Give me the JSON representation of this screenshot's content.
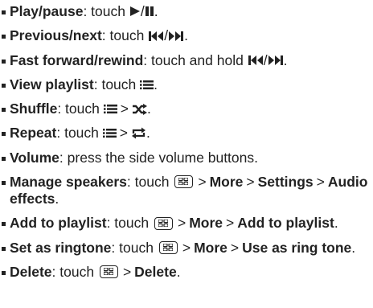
{
  "items": [
    {
      "term": "Play/pause",
      "pre": ": touch ",
      "icons": [
        "play-icon",
        "pause-icon"
      ],
      "sep": "/",
      "end": "."
    },
    {
      "term": "Previous/next",
      "pre": ": touch ",
      "icons": [
        "previous-icon",
        "next-icon"
      ],
      "sep": "/",
      "end": "."
    },
    {
      "term": "Fast forward/rewind",
      "pre": ": touch and hold ",
      "icons": [
        "previous-icon",
        "next-icon"
      ],
      "sep": "/",
      "end": "."
    },
    {
      "term": "View playlist",
      "pre": ": touch ",
      "icons": [
        "playlist-icon"
      ],
      "end": "."
    },
    {
      "term": "Shuffle",
      "pre": ": touch ",
      "icons": [
        "playlist-icon",
        "shuffle-icon"
      ],
      "gt": ">",
      "end": "."
    },
    {
      "term": "Repeat",
      "pre": ": touch ",
      "icons": [
        "playlist-icon",
        "repeat-icon"
      ],
      "gt": ">",
      "end": "."
    },
    {
      "term": "Volume",
      "pre": ": press the side volume buttons."
    },
    {
      "term": "Manage speakers",
      "pre": ": touch ",
      "icons": [
        "menu-icon"
      ],
      "gt": ">",
      "steps": [
        "More",
        "Settings",
        "Audio effects"
      ],
      "end": "."
    },
    {
      "term": "Add to playlist",
      "pre": ": touch ",
      "icons": [
        "menu-icon"
      ],
      "gt": ">",
      "steps": [
        "More",
        "Add to playlist"
      ],
      "end": "."
    },
    {
      "term": "Set as ringtone",
      "pre": ": touch ",
      "icons": [
        "menu-icon"
      ],
      "gt": ">",
      "steps": [
        "More",
        "Use as ring tone"
      ],
      "end": "."
    },
    {
      "term": "Delete",
      "pre": ": touch ",
      "icons": [
        "menu-icon"
      ],
      "gt": ">",
      "steps": [
        "Delete"
      ],
      "end": "."
    }
  ]
}
